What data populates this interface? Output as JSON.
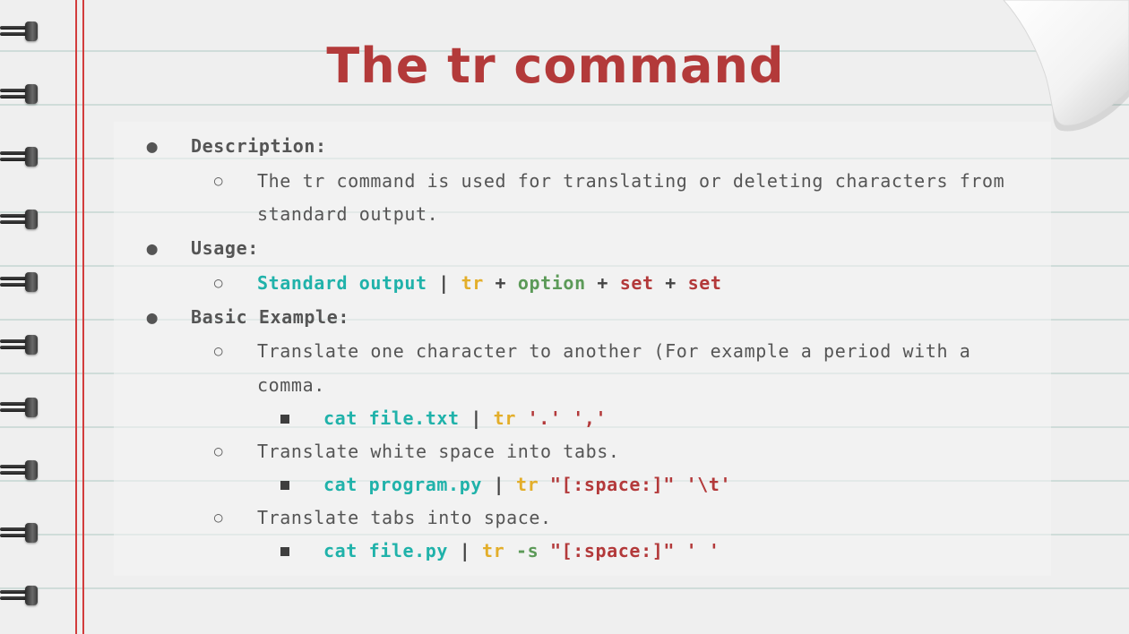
{
  "slide": {
    "title": "The tr command"
  },
  "colors": {
    "title": "#b33a3a",
    "margin_line": "#d23c3c",
    "ruled_line": "#cfdcd9",
    "code_command": "#20b2aa",
    "code_tr": "#e3ae2a",
    "code_option": "#5c9a58",
    "code_set": "#b3393a"
  },
  "icons": {
    "binding": "spiral-ring-icon",
    "corner": "page-curl-icon",
    "bullet_level1": "bullet-dot-icon",
    "bullet_level2": "bullet-circle-icon",
    "bullet_level3": "bullet-square-icon"
  },
  "bullets": {
    "l1": "●",
    "l2": "○"
  },
  "description": {
    "heading": "Description:",
    "text_line1": "The tr command is used for translating or deleting characters from",
    "text_line2": "standard output."
  },
  "usage": {
    "heading": "Usage:",
    "parts": {
      "input": "Standard output",
      "pipe": "|",
      "cmd": "tr",
      "plus1": "+",
      "option": "option",
      "plus2": "+",
      "set1": "set",
      "plus3": "+",
      "set2": "set"
    }
  },
  "examples": {
    "heading": "Basic Example:",
    "ex1": {
      "text_line1": "Translate one character  to another (For example a period with a",
      "text_line2": "comma.",
      "code": {
        "cmd": "cat file.txt",
        "pipe": "|",
        "tr": "tr",
        "args": "'.' ','"
      }
    },
    "ex2": {
      "text": "Translate white space into tabs.",
      "code": {
        "cmd": "cat program.py",
        "pipe": "|",
        "tr": "tr",
        "args": "\"[:space:]\" '\\t'"
      }
    },
    "ex3": {
      "text": "Translate tabs into space.",
      "code": {
        "cmd": "cat file.py",
        "pipe": "|",
        "tr": "tr",
        "flag": "-s",
        "args": "\"[:space:]\" ' '"
      }
    }
  }
}
